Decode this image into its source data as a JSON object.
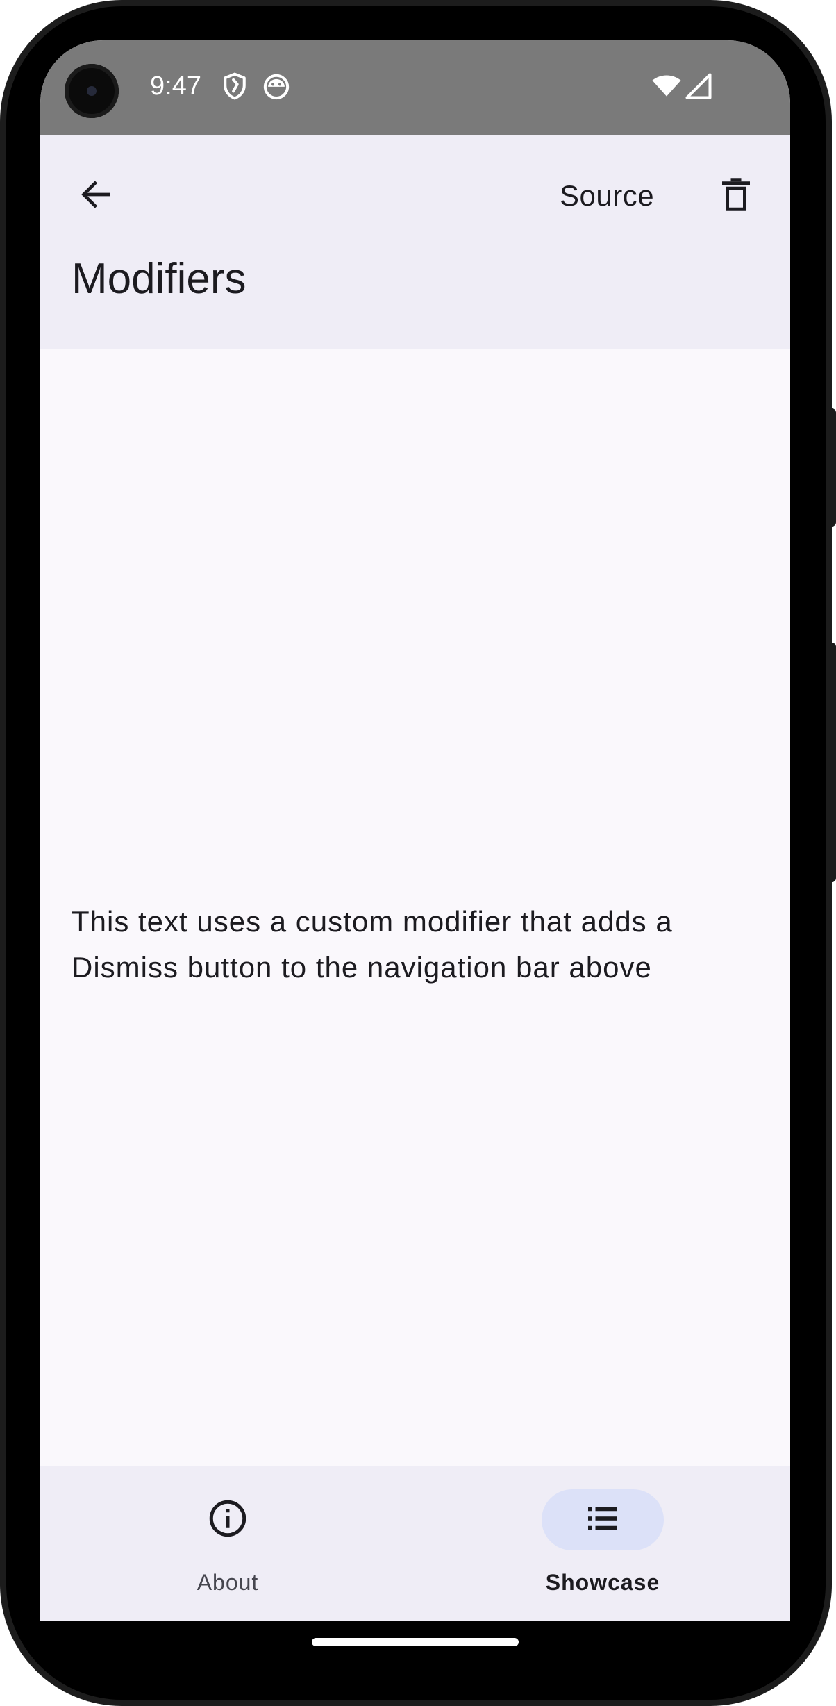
{
  "status_bar": {
    "time": "9:47",
    "icons": [
      "shield-icon",
      "android-head-icon",
      "wifi-icon",
      "cell-signal-icon"
    ]
  },
  "top_bar": {
    "back_icon": "arrow-back-icon",
    "source_label": "Source",
    "trash_icon": "trash-icon",
    "title": "Modifiers"
  },
  "content": {
    "text": "This text uses a custom modifier that adds a Dismiss button to the navigation bar above"
  },
  "bottom_nav": {
    "items": [
      {
        "label": "About",
        "icon": "info-icon",
        "selected": false
      },
      {
        "label": "Showcase",
        "icon": "list-icon",
        "selected": true
      }
    ]
  },
  "colors": {
    "status_bar_bg": "#7a7a7a",
    "top_bar_bg": "#efedf6",
    "content_bg": "#faf8fc",
    "active_pill": "#dce1f8",
    "text_primary": "#1c1b20",
    "text_secondary": "#46464f"
  }
}
